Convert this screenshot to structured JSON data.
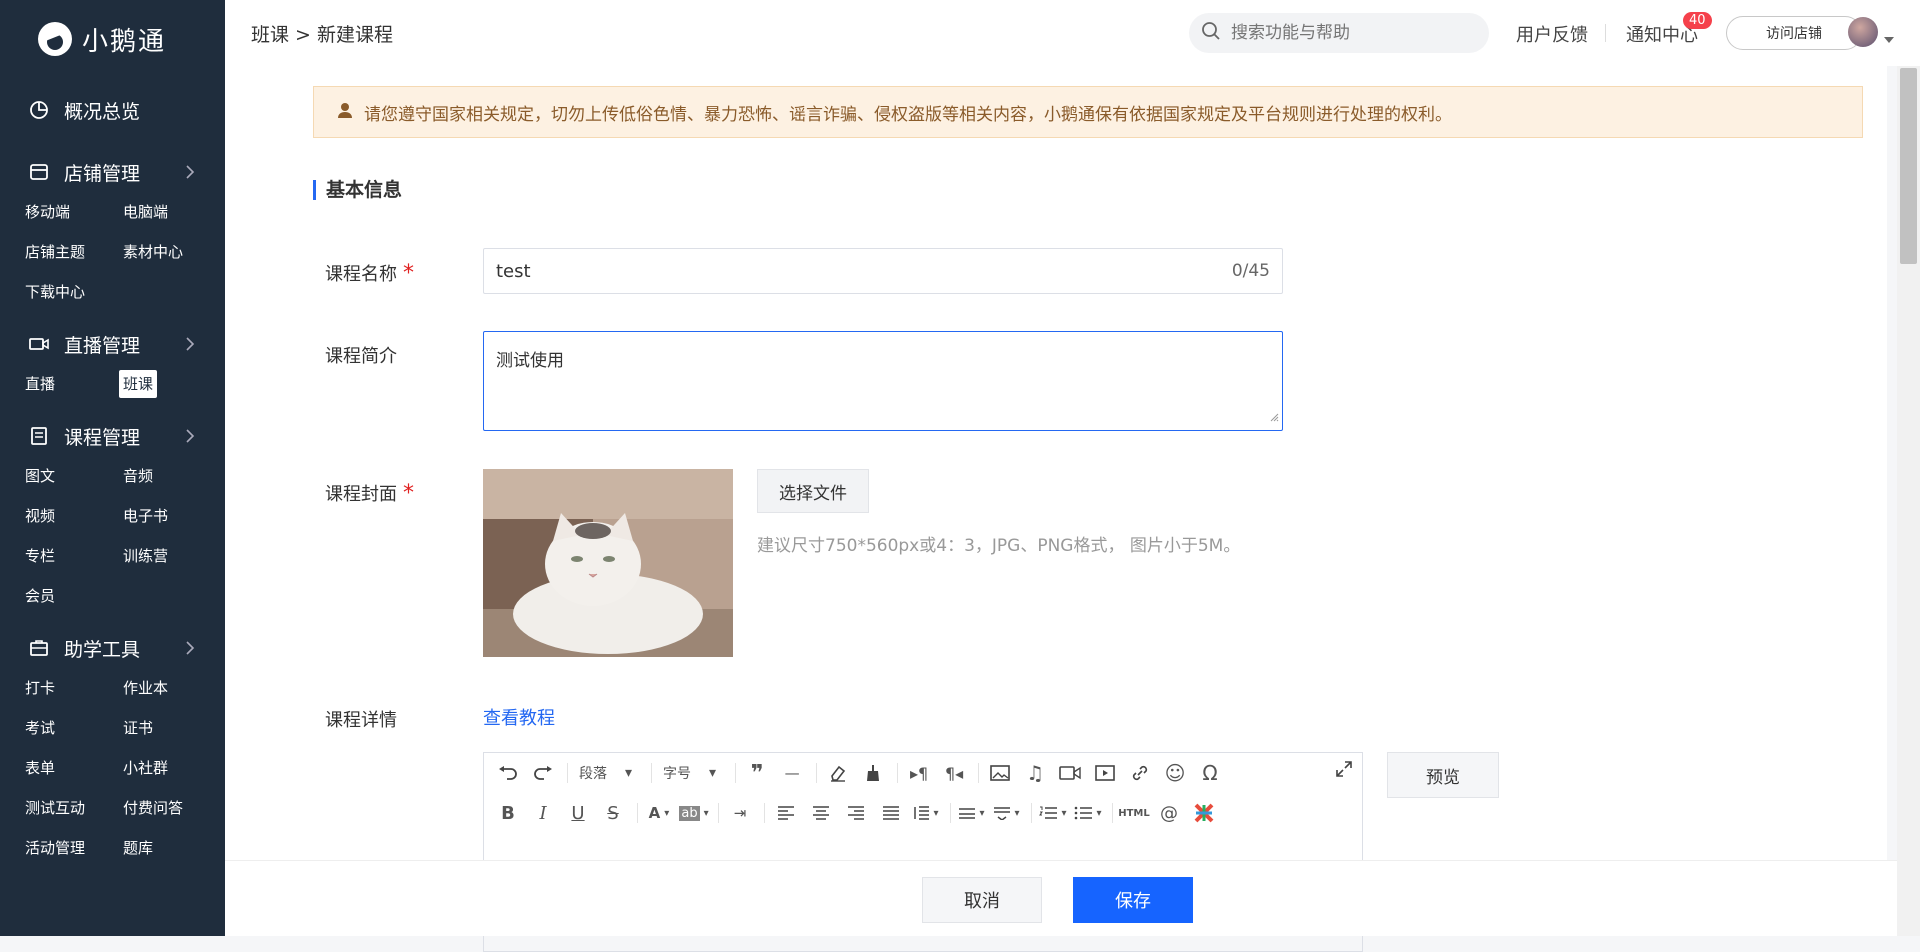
{
  "app": {
    "name": "小鹅通"
  },
  "sidebar": {
    "overview": "概况总览",
    "groups": [
      {
        "title": "店铺管理",
        "items": [
          "移动端",
          "电脑端",
          "店铺主题",
          "素材中心",
          "下载中心"
        ]
      },
      {
        "title": "直播管理",
        "items": [
          "直播",
          "班课"
        ]
      },
      {
        "title": "课程管理",
        "items": [
          "图文",
          "音频",
          "视频",
          "电子书",
          "专栏",
          "训练营",
          "会员"
        ]
      },
      {
        "title": "助学工具",
        "items": [
          "打卡",
          "作业本",
          "考试",
          "证书",
          "表单",
          "小社群",
          "测试互动",
          "付费问答",
          "活动管理",
          "题库"
        ]
      }
    ],
    "active_item": "班课"
  },
  "header": {
    "breadcrumb": "班课 > 新建课程",
    "search_placeholder": "搜索功能与帮助",
    "feedback": "用户反馈",
    "notifications": "通知中心",
    "notification_count": "40",
    "visit_store": "访问店铺"
  },
  "notice": "请您遵守国家相关规定，切勿上传低俗色情、暴力恐怖、谣言诈骗、侵权盗版等相关内容，小鹅通保有依据国家规定及平台规则进行处理的权利。",
  "form": {
    "section_title": "基本信息",
    "name_label": "课程名称",
    "name_value": "test",
    "name_count": "0/45",
    "intro_label": "课程简介",
    "intro_value": "测试使用",
    "cover_label": "课程封面",
    "choose_file": "选择文件",
    "cover_hint": "建议尺寸750*560px或4：3，JPG、PNG格式， 图片小于5M。",
    "detail_label": "课程详情",
    "tutorial_link": "查看教程",
    "paragraph_select": "段落",
    "fontsize_select": "字号",
    "preview": "预览"
  },
  "footer": {
    "cancel": "取消",
    "save": "保存"
  },
  "colors": {
    "sidebar_bg": "#1f2d3d",
    "primary": "#1664ff",
    "notice_bg": "#fdf1e2",
    "required": "#e02020"
  }
}
